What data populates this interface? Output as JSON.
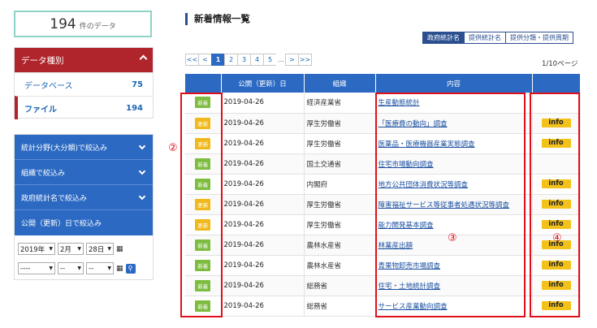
{
  "count": {
    "number": "194",
    "unit": "件のデータ"
  },
  "data_type": {
    "header": "データ種別",
    "items": [
      {
        "label": "データベース",
        "count": "75",
        "active": false
      },
      {
        "label": "ファイル",
        "count": "194",
        "active": true
      }
    ]
  },
  "filters": {
    "items": [
      "統計分野(大分類)で絞込み",
      "組織で絞込み",
      "政府統計名で絞込み"
    ],
    "date_label": "公開（更新）日で絞込み",
    "from": {
      "year": "2019年",
      "month": "2月",
      "day": "28日"
    },
    "to": {
      "year": "----",
      "month": "--",
      "day": "--"
    }
  },
  "main": {
    "title": "新着情報一覧",
    "tabs": [
      "政府統計名",
      "提供統計名",
      "提供分類・提供周期"
    ],
    "pager": {
      "first": "<<",
      "prev": "<",
      "pages": [
        "1",
        "2",
        "3",
        "4",
        "5"
      ],
      "dots": "...",
      "next": ">",
      "last": ">>",
      "current": "1",
      "info": "1/10ページ"
    },
    "columns": [
      "",
      "公開（更新）日",
      "組織",
      "内容",
      ""
    ],
    "rows": [
      {
        "badge": "新着",
        "type": "new",
        "date": "2019-04-26",
        "org": "経済産業省",
        "content": "生産動態統計",
        "info": ""
      },
      {
        "badge": "更新",
        "type": "upd",
        "date": "2019-04-26",
        "org": "厚生労働省",
        "content": "「医療費の動向」調査",
        "info": "info"
      },
      {
        "badge": "更新",
        "type": "upd",
        "date": "2019-04-26",
        "org": "厚生労働省",
        "content": "医薬品・医療機器産業実態調査",
        "info": "info"
      },
      {
        "badge": "新着",
        "type": "new",
        "date": "2019-04-26",
        "org": "国土交通省",
        "content": "住宅市場動向調査",
        "info": ""
      },
      {
        "badge": "新着",
        "type": "new",
        "date": "2019-04-26",
        "org": "内閣府",
        "content": "地方公共団体消費状況等調査",
        "info": "info"
      },
      {
        "badge": "更新",
        "type": "upd",
        "date": "2019-04-26",
        "org": "厚生労働省",
        "content": "障害福祉サービス等従事者処遇状況等調査",
        "info": "info"
      },
      {
        "badge": "更新",
        "type": "upd",
        "date": "2019-04-26",
        "org": "厚生労働省",
        "content": "能力開発基本調査",
        "info": "info"
      },
      {
        "badge": "新着",
        "type": "new",
        "date": "2019-04-26",
        "org": "農林水産省",
        "content": "林業産出額",
        "info": "info"
      },
      {
        "badge": "新着",
        "type": "new",
        "date": "2019-04-26",
        "org": "農林水産省",
        "content": "青果物卸売市場調査",
        "info": "info"
      },
      {
        "badge": "新着",
        "type": "new",
        "date": "2019-04-26",
        "org": "総務省",
        "content": "住宅・土地統計調査",
        "info": "info"
      },
      {
        "badge": "新着",
        "type": "new",
        "date": "2019-04-26",
        "org": "総務省",
        "content": "サービス産業動向調査",
        "info": "info"
      }
    ]
  },
  "annotations": {
    "m2": "②",
    "m3": "③",
    "m4": "④"
  },
  "colors": {
    "accent_red": "#b0242b",
    "primary_blue": "#2b69c2",
    "new_badge": "#7dbc3f",
    "update_badge": "#f1b81b",
    "annotation_red": "#e0101a"
  }
}
